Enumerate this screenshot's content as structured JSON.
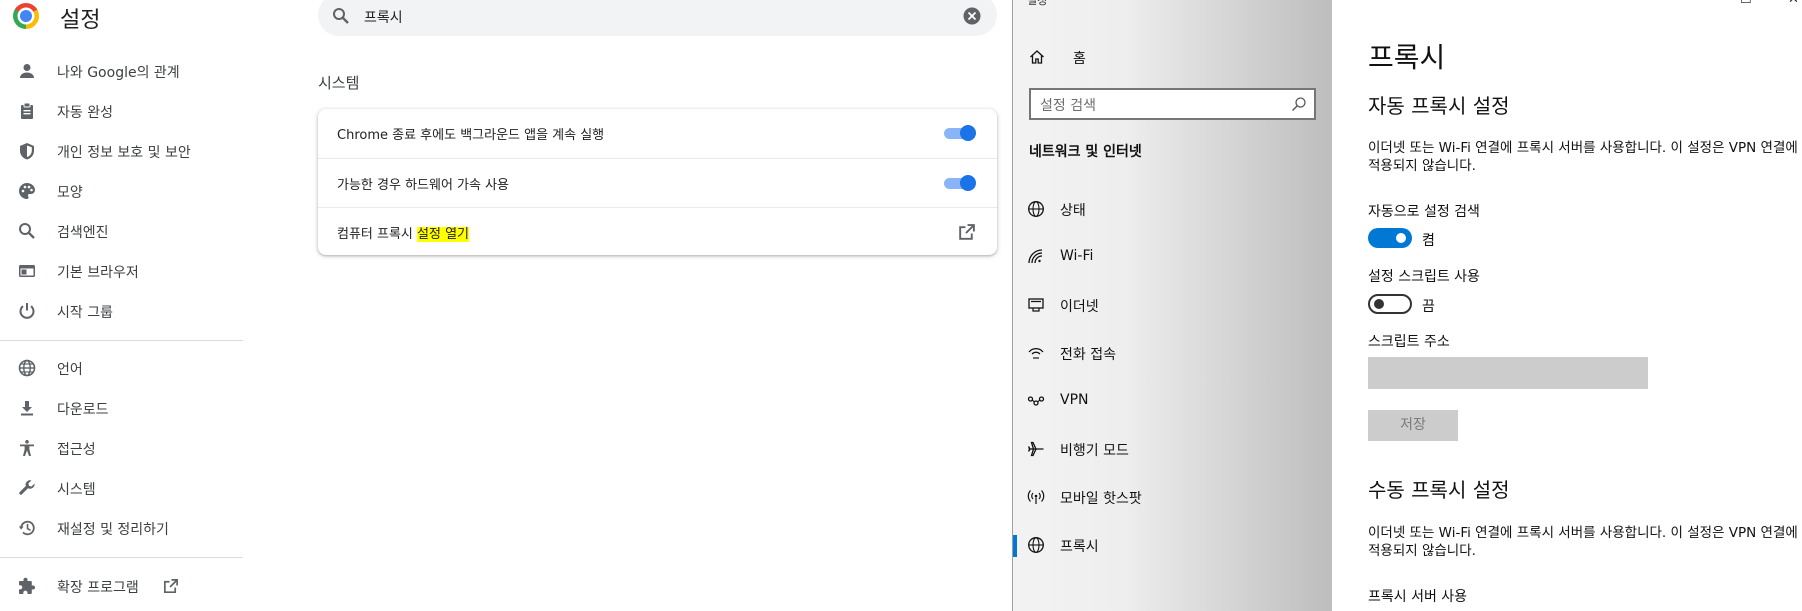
{
  "chrome": {
    "title": "설정",
    "search": {
      "query": "프록시"
    },
    "nav": [
      {
        "label": "나와 Google의 관계",
        "icon": "person-icon"
      },
      {
        "label": "자동 완성",
        "icon": "clipboard-icon"
      },
      {
        "label": "개인 정보 보호 및 보안",
        "icon": "shield-icon"
      },
      {
        "label": "모양",
        "icon": "palette-icon"
      },
      {
        "label": "검색엔진",
        "icon": "search-icon"
      },
      {
        "label": "기본 브라우저",
        "icon": "browser-icon"
      },
      {
        "label": "시작 그룹",
        "icon": "power-icon"
      },
      {
        "label": "언어",
        "icon": "globe-icon"
      },
      {
        "label": "다운로드",
        "icon": "download-icon"
      },
      {
        "label": "접근성",
        "icon": "accessibility-icon"
      },
      {
        "label": "시스템",
        "icon": "wrench-icon"
      },
      {
        "label": "재설정 및 정리하기",
        "icon": "history-icon"
      },
      {
        "label": "확장 프로그램",
        "icon": "puzzle-icon"
      }
    ],
    "section_title": "시스템",
    "settings": [
      {
        "label": "Chrome 종료 후에도 백그라운드 앱을 계속 실행",
        "toggle": true
      },
      {
        "label": "가능한 경우 하드웨어 가속 사용",
        "toggle": true
      },
      {
        "label_prefix": "컴퓨터 프록시 ",
        "label_highlight": "설정 열기"
      }
    ],
    "accent_color": "#1a73e8",
    "highlight_color": "#ffff00"
  },
  "windows": {
    "app_name": "설정",
    "home_label": "홈",
    "search_placeholder": "설정 검색",
    "category": "네트워크 및 인터넷",
    "nav": [
      {
        "label": "상태",
        "icon": "status-globe-icon"
      },
      {
        "label": "Wi-Fi",
        "icon": "wifi-icon"
      },
      {
        "label": "이더넷",
        "icon": "ethernet-icon"
      },
      {
        "label": "전화 접속",
        "icon": "dialup-icon"
      },
      {
        "label": "VPN",
        "icon": "vpn-icon"
      },
      {
        "label": "비행기 모드",
        "icon": "airplane-icon"
      },
      {
        "label": "모바일 핫스팟",
        "icon": "hotspot-icon"
      },
      {
        "label": "프록시",
        "icon": "proxy-globe-icon",
        "active": true
      }
    ],
    "page_title": "프록시",
    "auto_section": {
      "title": "자동 프록시 설정",
      "description": "이더넷 또는 Wi-Fi 연결에 프록시 서버를 사용합니다. 이 설정은 VPN 연결에 적용되지 않습니다.",
      "auto_detect_label": "자동으로 설정 검색",
      "auto_detect_state": "켬",
      "script_label": "설정 스크립트 사용",
      "script_state": "끔",
      "script_address_label": "스크립트 주소",
      "script_address_value": "",
      "save_label": "저장"
    },
    "manual_section": {
      "title": "수동 프록시 설정",
      "description": "이더넷 또는 Wi-Fi 연결에 프록시 서버를 사용합니다. 이 설정은 VPN 연결에 적용되지 않습니다.",
      "use_proxy_label": "프록시 서버 사용"
    },
    "accent_color": "#0078d4"
  }
}
